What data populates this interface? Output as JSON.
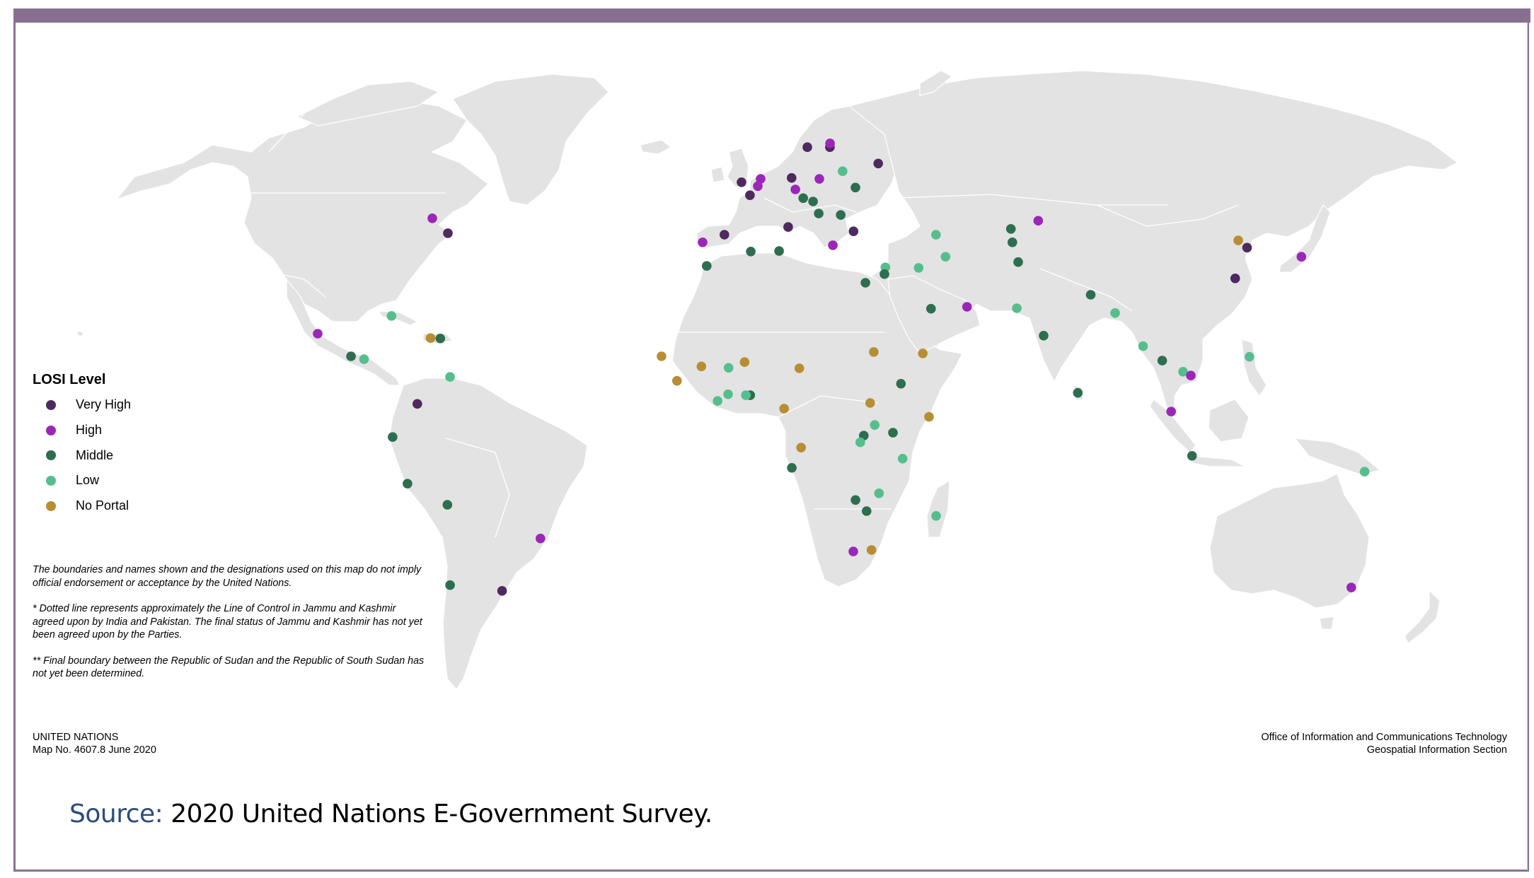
{
  "legend": {
    "title": "LOSI Level",
    "levels": [
      {
        "key": "very_high",
        "label": "Very High",
        "color": "#4e2a5e"
      },
      {
        "key": "high",
        "label": "High",
        "color": "#9b27b8"
      },
      {
        "key": "middle",
        "label": "Middle",
        "color": "#2e6e50"
      },
      {
        "key": "low",
        "label": "Low",
        "color": "#56be8e"
      },
      {
        "key": "no_portal",
        "label": "No Portal",
        "color": "#b88e35"
      }
    ]
  },
  "colors": {
    "land": "#e3e3e3",
    "frame": "#87708f",
    "source_label": "#2c4c7c"
  },
  "disclaimer": {
    "p1": "The boundaries and names shown and the designations used on this map do not imply official endorsement or acceptance by the United Nations.",
    "p2": "* Dotted line represents approximately the Line of Control in Jammu and Kashmir agreed upon by India and Pakistan. The final status of Jammu and Kashmir has not yet been agreed upon by the Parties.",
    "p3": "** Final boundary between the Republic of Sudan and the Republic of South Sudan has not yet been determined."
  },
  "credits": {
    "org": "UNITED NATIONS",
    "map_no": "Map No. 4607.8  June 2020",
    "office_line1": "Office of Information and Communications Technology",
    "office_line2": "Geospatial Information Section"
  },
  "source": {
    "label": "Source:",
    "text": " 2020 United Nations E-Government Survey."
  },
  "cities": [
    {
      "lon": 18.4,
      "lat": 58.5,
      "level": "very_high"
    },
    {
      "lon": 24.7,
      "lat": 58.5,
      "level": "very_high"
    },
    {
      "lon": 24.9,
      "lat": 59.3,
      "level": "high"
    },
    {
      "lon": 37.3,
      "lat": 55.1,
      "level": "very_high"
    },
    {
      "lon": 27.3,
      "lat": 53.5,
      "level": "low"
    },
    {
      "lon": 0.0,
      "lat": 51.2,
      "level": "very_high"
    },
    {
      "lon": 5.1,
      "lat": 51.9,
      "level": "high"
    },
    {
      "lon": 4.3,
      "lat": 50.4,
      "level": "high"
    },
    {
      "lon": 13.4,
      "lat": 52.1,
      "level": "very_high"
    },
    {
      "lon": 20.8,
      "lat": 51.9,
      "level": "high"
    },
    {
      "lon": 2.2,
      "lat": 48.5,
      "level": "very_high"
    },
    {
      "lon": 14.2,
      "lat": 49.7,
      "level": "high"
    },
    {
      "lon": 30.1,
      "lat": 50.1,
      "level": "middle"
    },
    {
      "lon": 16.1,
      "lat": 47.9,
      "level": "middle"
    },
    {
      "lon": 18.6,
      "lat": 47.2,
      "level": "middle"
    },
    {
      "lon": 19.8,
      "lat": 44.7,
      "level": "middle"
    },
    {
      "lon": 25.4,
      "lat": 44.4,
      "level": "middle"
    },
    {
      "lon": 11.8,
      "lat": 41.9,
      "level": "very_high"
    },
    {
      "lon": 28.2,
      "lat": 41.0,
      "level": "very_high"
    },
    {
      "lon": -4.3,
      "lat": 40.3,
      "level": "very_high"
    },
    {
      "lon": -9.7,
      "lat": 38.7,
      "level": "high"
    },
    {
      "lon": 22.7,
      "lat": 38.1,
      "level": "high"
    },
    {
      "lon": 2.3,
      "lat": 36.8,
      "level": "middle"
    },
    {
      "lon": 9.3,
      "lat": 36.9,
      "level": "middle"
    },
    {
      "lon": -8.5,
      "lat": 33.8,
      "level": "middle"
    },
    {
      "lon": 48.8,
      "lat": 40.3,
      "level": "low"
    },
    {
      "lon": 50.2,
      "lat": 35.7,
      "level": "low"
    },
    {
      "lon": 43.2,
      "lat": 33.4,
      "level": "low"
    },
    {
      "lon": 35.1,
      "lat": 33.5,
      "level": "low"
    },
    {
      "lon": 34.7,
      "lat": 32.1,
      "level": "middle"
    },
    {
      "lon": 29.9,
      "lat": 30.3,
      "level": "middle"
    },
    {
      "lon": 45.0,
      "lat": 24.9,
      "level": "middle"
    },
    {
      "lon": 53.6,
      "lat": 25.3,
      "level": "high"
    },
    {
      "lon": 68.0,
      "lat": 41.5,
      "level": "middle"
    },
    {
      "lon": 67.5,
      "lat": 38.7,
      "level": "middle"
    },
    {
      "lon": 75.5,
      "lat": 43.2,
      "level": "high"
    },
    {
      "lon": 67.8,
      "lat": 34.6,
      "level": "middle"
    },
    {
      "lon": 65.4,
      "lat": 25.0,
      "level": "low"
    },
    {
      "lon": 83.6,
      "lat": 27.8,
      "level": "middle"
    },
    {
      "lon": 88.5,
      "lat": 24.0,
      "level": "low"
    },
    {
      "lon": 70.8,
      "lat": 19.3,
      "level": "middle"
    },
    {
      "lon": 77.5,
      "lat": 7.4,
      "level": "middle"
    },
    {
      "lon": 93.7,
      "lat": 17.1,
      "level": "low"
    },
    {
      "lon": 97.7,
      "lat": 14.1,
      "level": "middle"
    },
    {
      "lon": 102.2,
      "lat": 11.8,
      "level": "low"
    },
    {
      "lon": 103.9,
      "lat": 11.0,
      "level": "high"
    },
    {
      "lon": 118.1,
      "lat": 14.9,
      "level": "low"
    },
    {
      "lon": 98.8,
      "lat": 3.5,
      "level": "high"
    },
    {
      "lon": 103.7,
      "lat": -5.7,
      "level": "middle"
    },
    {
      "lon": 124.0,
      "lat": 39.1,
      "level": "no_portal"
    },
    {
      "lon": 125.4,
      "lat": 37.6,
      "level": "very_high"
    },
    {
      "lon": 137.8,
      "lat": 35.7,
      "level": "high"
    },
    {
      "lon": 119.5,
      "lat": 31.2,
      "level": "very_high"
    },
    {
      "lon": -18.6,
      "lat": 15.0,
      "level": "no_portal"
    },
    {
      "lon": -9.3,
      "lat": 12.9,
      "level": "no_portal"
    },
    {
      "lon": -3.0,
      "lat": 12.6,
      "level": "low"
    },
    {
      "lon": 0.7,
      "lat": 13.8,
      "level": "no_portal"
    },
    {
      "lon": 13.4,
      "lat": 12.5,
      "level": "no_portal"
    },
    {
      "lon": -14.9,
      "lat": 9.9,
      "level": "no_portal"
    },
    {
      "lon": -3.1,
      "lat": 7.1,
      "level": "low"
    },
    {
      "lon": -5.5,
      "lat": 5.7,
      "level": "low"
    },
    {
      "lon": 2.0,
      "lat": 6.9,
      "level": "middle"
    },
    {
      "lon": 1.0,
      "lat": 6.9,
      "level": "low"
    },
    {
      "lon": 9.8,
      "lat": 4.1,
      "level": "no_portal"
    },
    {
      "lon": 30.8,
      "lat": 15.9,
      "level": "no_portal"
    },
    {
      "lon": 42.2,
      "lat": 15.6,
      "level": "no_portal"
    },
    {
      "lon": 36.8,
      "lat": 9.3,
      "level": "middle"
    },
    {
      "lon": 29.6,
      "lat": 5.3,
      "level": "no_portal"
    },
    {
      "lon": 43.1,
      "lat": 2.4,
      "level": "no_portal"
    },
    {
      "lon": 30.6,
      "lat": 0.7,
      "level": "low"
    },
    {
      "lon": 28.1,
      "lat": -1.5,
      "level": "middle"
    },
    {
      "lon": 27.3,
      "lat": -2.9,
      "level": "low"
    },
    {
      "lon": 34.8,
      "lat": -0.9,
      "level": "middle"
    },
    {
      "lon": 13.7,
      "lat": -4.0,
      "level": "no_portal"
    },
    {
      "lon": 37.1,
      "lat": -6.3,
      "level": "low"
    },
    {
      "lon": 11.6,
      "lat": -8.2,
      "level": "middle"
    },
    {
      "lon": 31.9,
      "lat": -13.5,
      "level": "low"
    },
    {
      "lon": 26.5,
      "lat": -14.9,
      "level": "middle"
    },
    {
      "lon": 29.2,
      "lat": -17.2,
      "level": "middle"
    },
    {
      "lon": 45.5,
      "lat": -18.2,
      "level": "low"
    },
    {
      "lon": 26.6,
      "lat": -25.6,
      "level": "high"
    },
    {
      "lon": 30.9,
      "lat": -25.3,
      "level": "no_portal"
    },
    {
      "lon": -78.9,
      "lat": 43.7,
      "level": "high"
    },
    {
      "lon": -73.8,
      "lat": 40.6,
      "level": "very_high"
    },
    {
      "lon": -82.8,
      "lat": 23.4,
      "level": "low"
    },
    {
      "lon": -99.4,
      "lat": 19.7,
      "level": "high"
    },
    {
      "lon": -72.8,
      "lat": 18.8,
      "level": "no_portal"
    },
    {
      "lon": -70.5,
      "lat": 18.7,
      "level": "middle"
    },
    {
      "lon": -90.8,
      "lat": 15.0,
      "level": "middle"
    },
    {
      "lon": -87.7,
      "lat": 14.4,
      "level": "low"
    },
    {
      "lon": -67.4,
      "lat": 10.7,
      "level": "low"
    },
    {
      "lon": -74.6,
      "lat": 5.1,
      "level": "very_high"
    },
    {
      "lon": -80.2,
      "lat": -1.8,
      "level": "middle"
    },
    {
      "lon": -77.3,
      "lat": -11.5,
      "level": "middle"
    },
    {
      "lon": -68.5,
      "lat": -15.9,
      "level": "middle"
    },
    {
      "lon": -47.5,
      "lat": -22.9,
      "level": "high"
    },
    {
      "lon": -70.9,
      "lat": -32.6,
      "level": "middle"
    },
    {
      "lon": -58.5,
      "lat": -33.8,
      "level": "very_high"
    },
    {
      "lon": 143.8,
      "lat": -9.0,
      "level": "low"
    },
    {
      "lon": 148.6,
      "lat": -33.1,
      "level": "high"
    }
  ]
}
